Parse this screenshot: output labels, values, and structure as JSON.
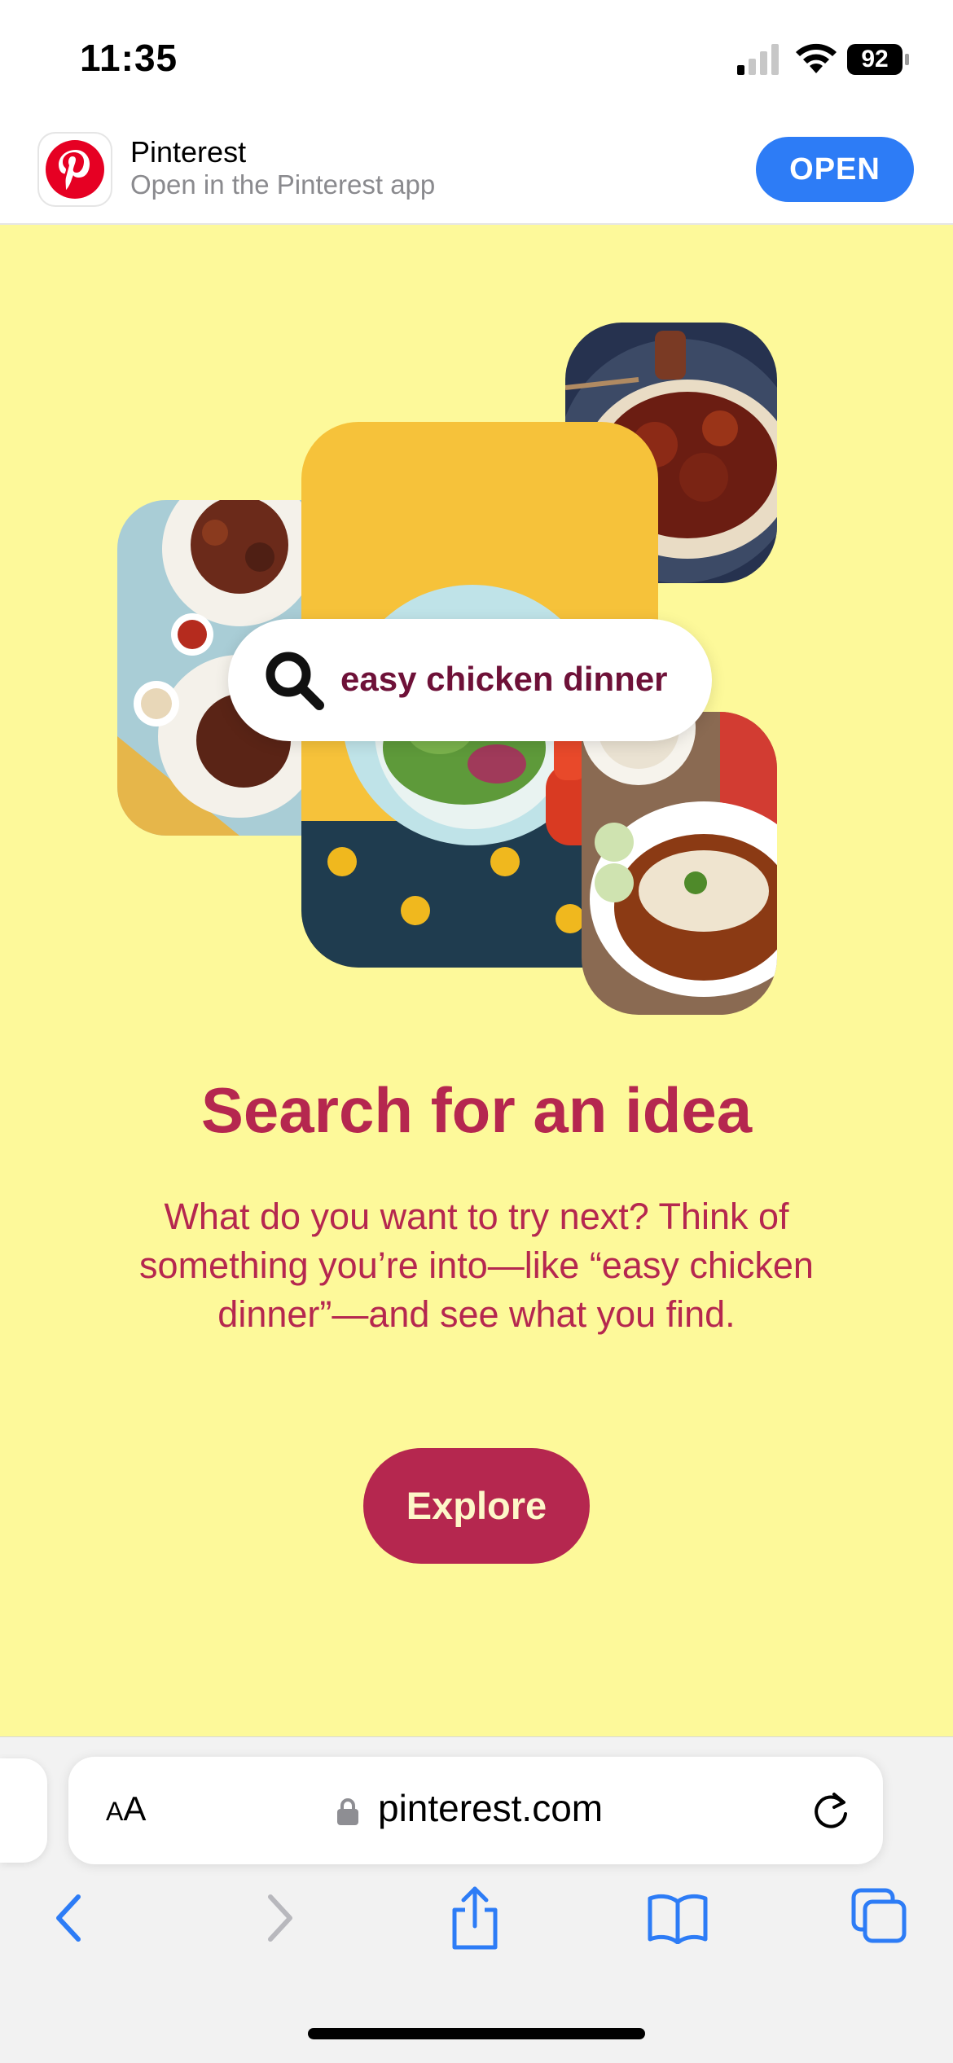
{
  "status_bar": {
    "time": "11:35",
    "battery": "92"
  },
  "app_banner": {
    "app_name": "Pinterest",
    "subtitle": "Open in the Pinterest app",
    "open_label": "OPEN",
    "icon": "pinterest-logo"
  },
  "hero": {
    "search_query": "easy chicken dinner",
    "search_icon": "search-icon"
  },
  "content": {
    "headline": "Search for an idea",
    "body": "What do you want to try next? Think of something you’re into—like “easy chicken dinner”—and see what you find.",
    "cta_label": "Explore"
  },
  "browser": {
    "text_size_label_small": "A",
    "text_size_label_large": "A",
    "url": "pinterest.com",
    "toolbar_icons": [
      "back-icon",
      "forward-icon",
      "share-icon",
      "bookmarks-icon",
      "tabs-icon"
    ]
  },
  "colors": {
    "background": "#fdf99a",
    "brand_red": "#b5274f",
    "open_button": "#2d7cf6"
  }
}
